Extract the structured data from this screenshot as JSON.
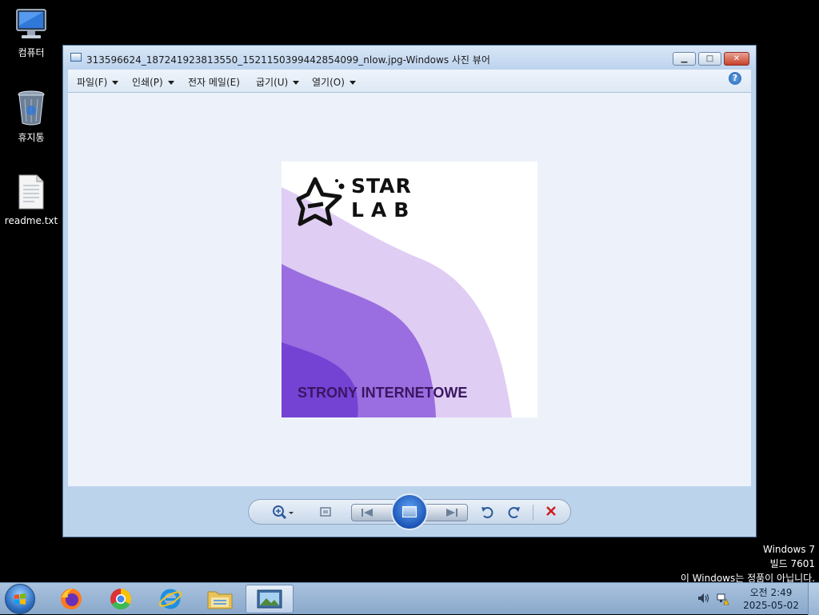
{
  "desktop": {
    "icons": [
      {
        "label": "컴퓨터"
      },
      {
        "label": "휴지통"
      },
      {
        "label": "readme.txt"
      }
    ]
  },
  "window": {
    "title": "313596624_187241923813550_1521150399442854099_nlow.jpg-Windows 사진 뷰어",
    "caption_buttons": {
      "minimize": "▁",
      "maximize": "□",
      "close": "✕"
    },
    "menu": [
      {
        "label": "파일(F)",
        "has_arrow": true
      },
      {
        "label": "인쇄(P)",
        "has_arrow": true
      },
      {
        "label": "전자 메일(E)",
        "has_arrow": false
      },
      {
        "label": "굽기(U)",
        "has_arrow": true
      },
      {
        "label": "열기(O)",
        "has_arrow": true
      }
    ],
    "help_label": "?"
  },
  "photo": {
    "logo_line1": "STAR",
    "logo_line2": "LAB",
    "caption": "STRONY INTERNETOWE",
    "colors": {
      "light": "#dfcdf4",
      "mid": "#9a6ee0",
      "dark": "#7443d4"
    }
  },
  "controls": {
    "zoom_icon": "zoom-icon",
    "fit_icon": "actual-size-icon",
    "prev_icon": "previous-icon",
    "slideshow_icon": "slideshow-icon",
    "next_icon": "next-icon",
    "rotate_left_icon": "rotate-counterclockwise-icon",
    "rotate_right_icon": "rotate-clockwise-icon",
    "delete_icon": "delete-icon"
  },
  "watermark": {
    "line1": "Windows 7",
    "line2": "빌드 7601",
    "line3": "이 Windows는 정품이 아닙니다."
  },
  "taskbar": {
    "pinned": [
      "firefox",
      "chrome",
      "internet-explorer",
      "file-explorer",
      "photo-viewer"
    ],
    "clock_time": "오전 2:49",
    "clock_date": "2025-05-02"
  }
}
